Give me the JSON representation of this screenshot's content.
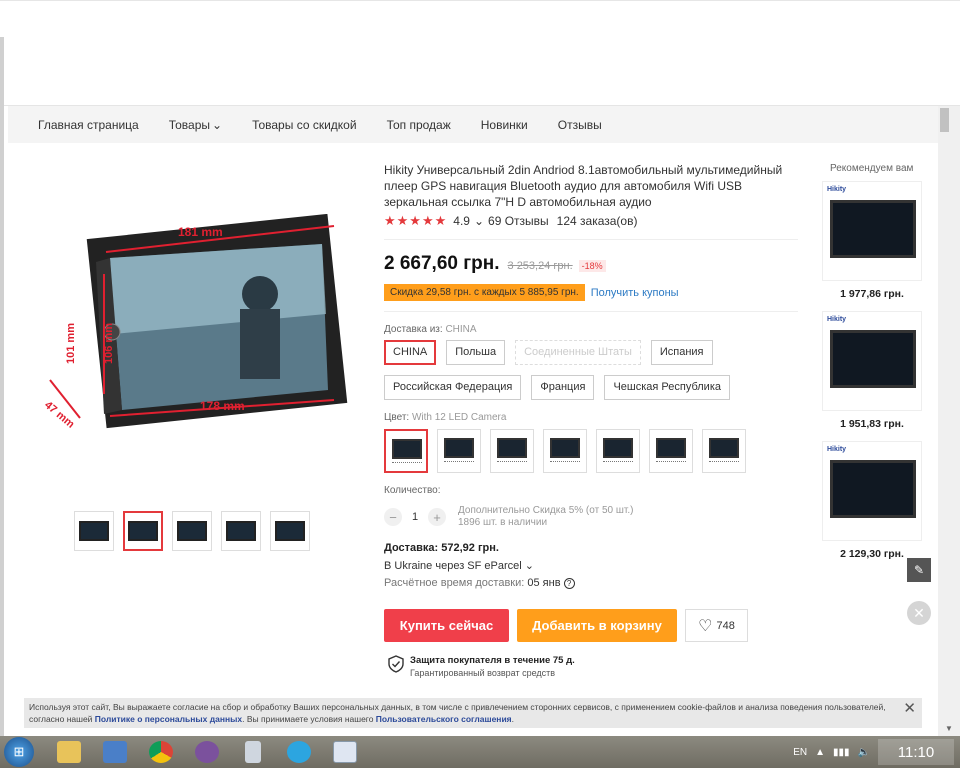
{
  "nav": {
    "items": [
      "Главная страница",
      "Товары",
      "Товары со скидкой",
      "Топ продаж",
      "Новинки",
      "Отзывы"
    ]
  },
  "product": {
    "title": "Hikity Универсальный 2din Andriod 8.1автомобильный мультимедийный плеер GPS навигация Bluetooth аудио для автомобиля Wifi USB зеркальная ссылка 7\"H D автомобильная аудио",
    "image_labels": [
      "181 mm",
      "178 mm",
      "47 mm",
      "101 mm",
      "106 mm"
    ],
    "rating": "4.9",
    "reviews": "69 Отзывы",
    "orders": "124 заказа(ов)",
    "price": "2 667,60 грн.",
    "old_price": "3 253,24 грн.",
    "discount": "-18%",
    "promo_badge": "Скидка 29,58 грн. с каждых 5 885,95 грн.",
    "coupon_link": "Получить купоны"
  },
  "shipping": {
    "label": "Доставка из:",
    "selected": "CHINA",
    "options": [
      "CHINA",
      "Польша",
      "Соединенные Штаты",
      "Испания",
      "Российская Федерация",
      "Франция",
      "Чешская Республика"
    ]
  },
  "color": {
    "label": "Цвет:",
    "selected": "With 12 LED Camera"
  },
  "quantity": {
    "label": "Количество:",
    "value": "1",
    "minus": "−",
    "plus": "+",
    "bulk": "Дополнительно Скидка 5% (от 50 шт.)",
    "stock": "1896 шт. в наличии"
  },
  "delivery": {
    "cost_label": "Доставка: 572,92 грн.",
    "via": "В Ukraine через SF eParcel",
    "eta_label": "Расчётное время доставки:",
    "eta_value": "05 янв"
  },
  "actions": {
    "buy": "Купить сейчас",
    "cart": "Добавить в корзину",
    "wish_count": "748"
  },
  "protection": {
    "title": "Защита покупателя в течение 75 д.",
    "subtitle": "Гарантированный возврат средств"
  },
  "recommendations": {
    "title": "Рекомендуем вам",
    "items": [
      {
        "brand": "Hikity",
        "price": "1 977,86 грн."
      },
      {
        "brand": "Hikity",
        "price": "1 951,83 грн."
      },
      {
        "brand": "Hikity",
        "price": "2 129,30 грн."
      }
    ]
  },
  "cookie": {
    "text1": "Используя этот сайт, Вы выражаете согласие на сбор и обработку Ваших персональных данных, в том числе с привлечением сторонних сервисов, с применением cookie-файлов и анализа поведения пользователей, согласно нашей ",
    "link1": "Политике о персональных данных",
    "text2": ". Вы принимаете условия нашего ",
    "link2": "Пользовательского соглашения",
    "text3": "."
  },
  "taskbar": {
    "lang": "EN",
    "time": "11:10"
  },
  "colors": {
    "accent_red": "#f03f4a",
    "accent_orange": "#ff9e1b",
    "link_blue": "#2c7ac4"
  }
}
